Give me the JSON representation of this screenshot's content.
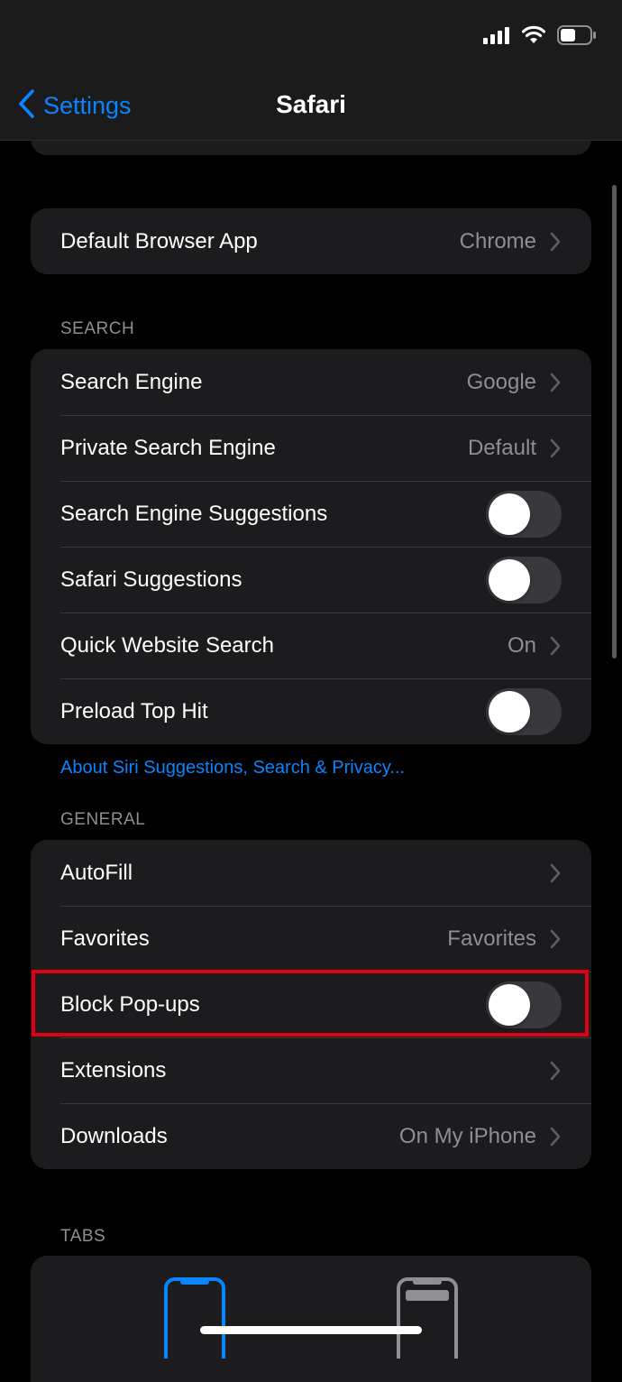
{
  "nav": {
    "back_label": "Settings",
    "title": "Safari"
  },
  "groups": {
    "browser": {
      "default_browser": {
        "label": "Default Browser App",
        "value": "Chrome"
      }
    },
    "search": {
      "header": "SEARCH",
      "search_engine": {
        "label": "Search Engine",
        "value": "Google"
      },
      "private_search_engine": {
        "label": "Private Search Engine",
        "value": "Default"
      },
      "search_engine_suggestions": {
        "label": "Search Engine Suggestions",
        "on": false
      },
      "safari_suggestions": {
        "label": "Safari Suggestions",
        "on": false
      },
      "quick_website_search": {
        "label": "Quick Website Search",
        "value": "On"
      },
      "preload_top_hit": {
        "label": "Preload Top Hit",
        "on": false
      },
      "footer_link": "About Siri Suggestions, Search & Privacy..."
    },
    "general": {
      "header": "GENERAL",
      "autofill": {
        "label": "AutoFill"
      },
      "favorites": {
        "label": "Favorites",
        "value": "Favorites"
      },
      "block_popups": {
        "label": "Block Pop-ups",
        "on": false
      },
      "extensions": {
        "label": "Extensions"
      },
      "downloads": {
        "label": "Downloads",
        "value": "On My iPhone"
      }
    },
    "tabs": {
      "header": "TABS"
    }
  },
  "colors": {
    "accent": "#0a84ff",
    "highlight": "#e1000f"
  }
}
